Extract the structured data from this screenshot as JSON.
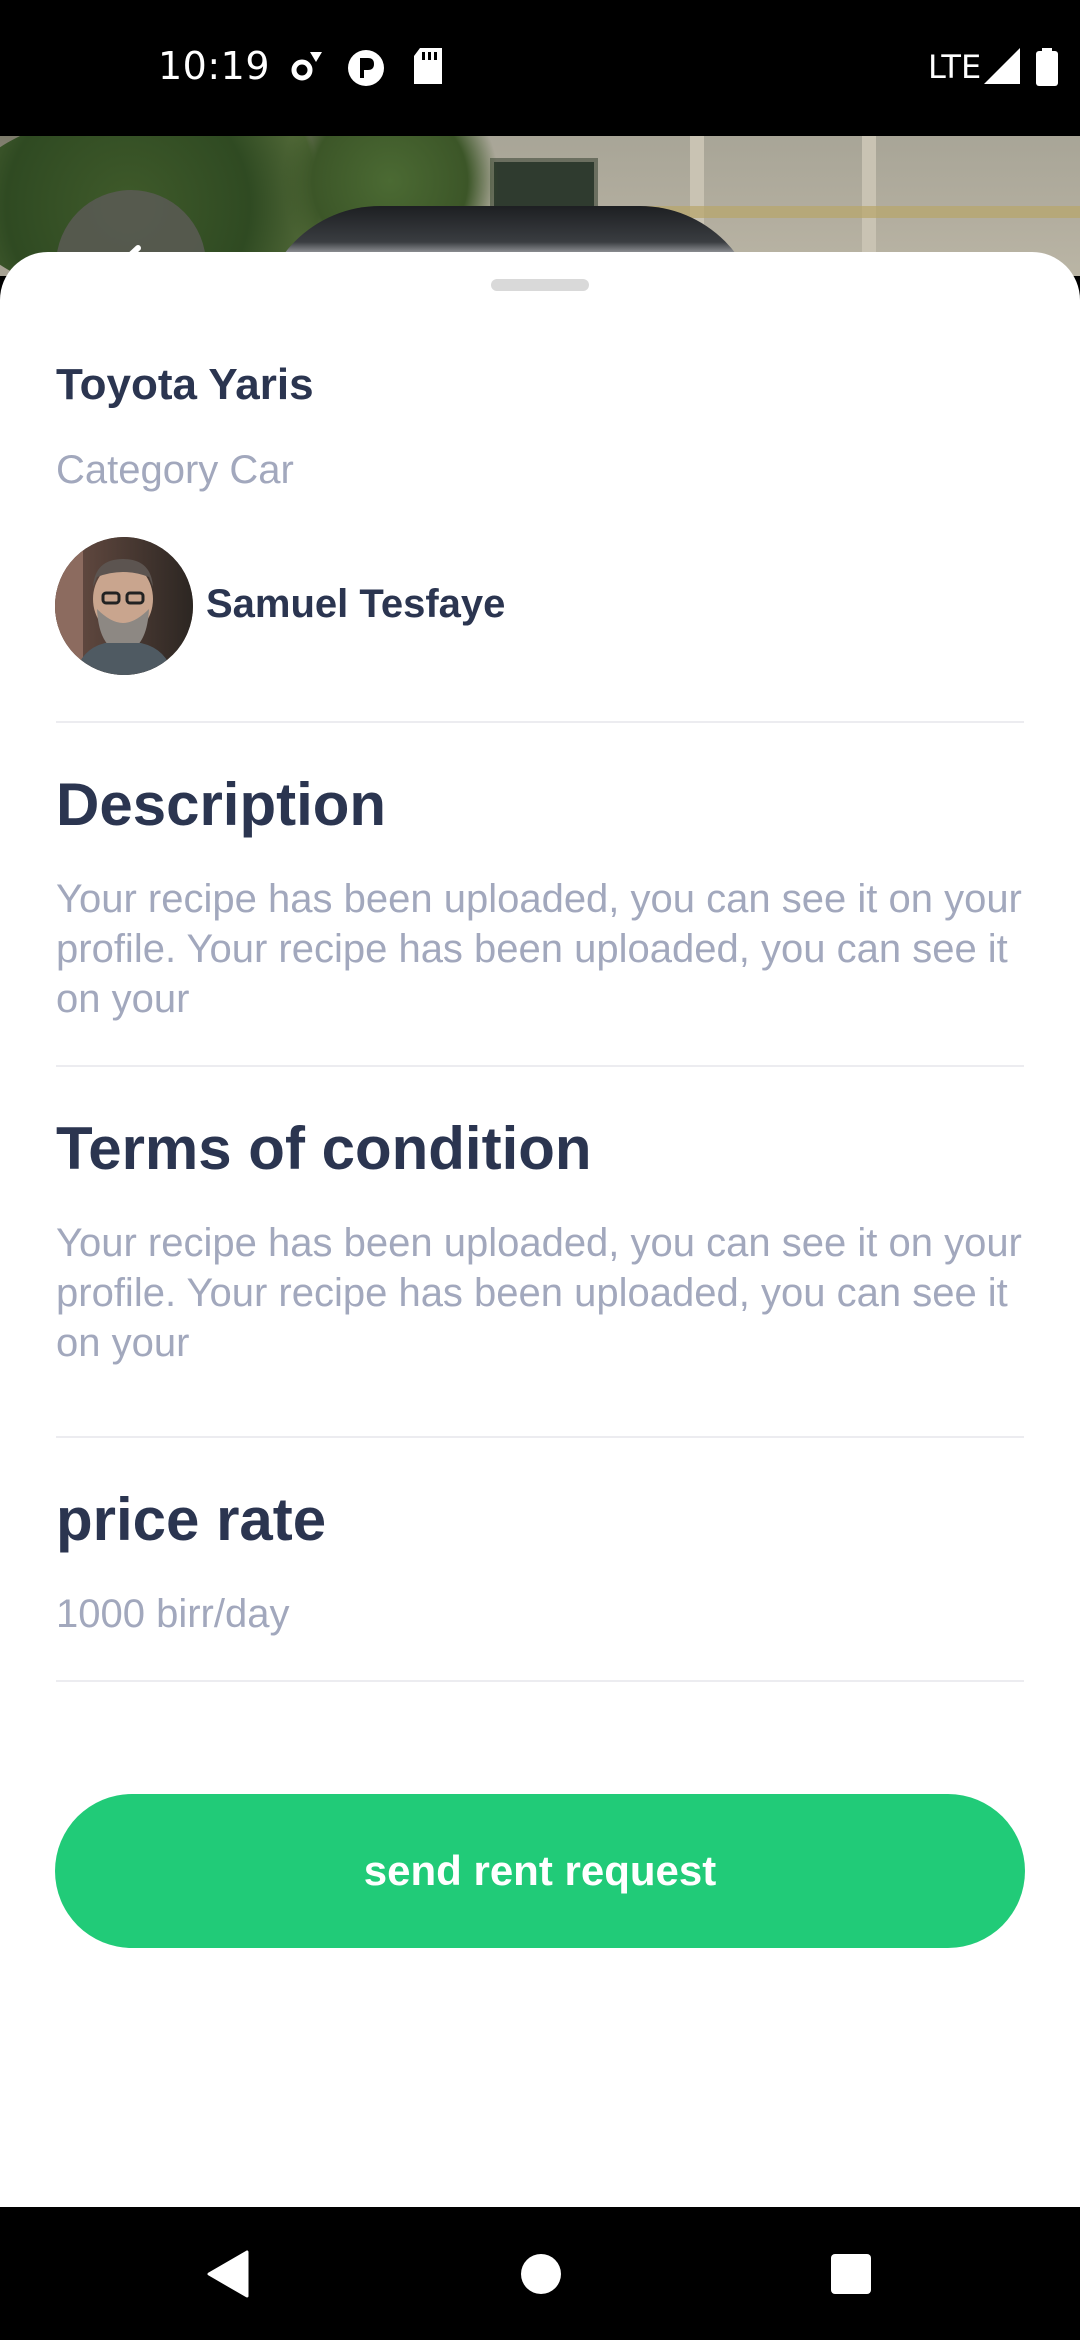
{
  "status_bar": {
    "time": "10:19",
    "network": "LTE",
    "icons": [
      "settings-icon",
      "pocket-icon",
      "sd-card-icon",
      "signal-icon",
      "battery-icon"
    ]
  },
  "hero": {
    "back_icon": "back-arrow-icon"
  },
  "listing": {
    "title": "Toyota Yaris",
    "category": "Category Car",
    "owner": {
      "name": "Samuel Tesfaye"
    }
  },
  "sections": {
    "description": {
      "title": "Description",
      "text": "Your recipe has been uploaded, you can see it on your profile. Your recipe has been uploaded, you can see it on your"
    },
    "terms": {
      "title": "Terms of condition",
      "text": "Your recipe has been uploaded, you can see it on your profile. Your recipe has been uploaded, you can see it on your"
    },
    "price": {
      "title": "price rate",
      "text": "1000 birr/day"
    }
  },
  "actions": {
    "rent_button": "send rent request"
  },
  "colors": {
    "accent": "#21cb78",
    "heading": "#2b3550",
    "muted": "#a2a8bd"
  },
  "nav_bar": {
    "icons": [
      "back-triangle-icon",
      "home-circle-icon",
      "recents-square-icon"
    ]
  }
}
